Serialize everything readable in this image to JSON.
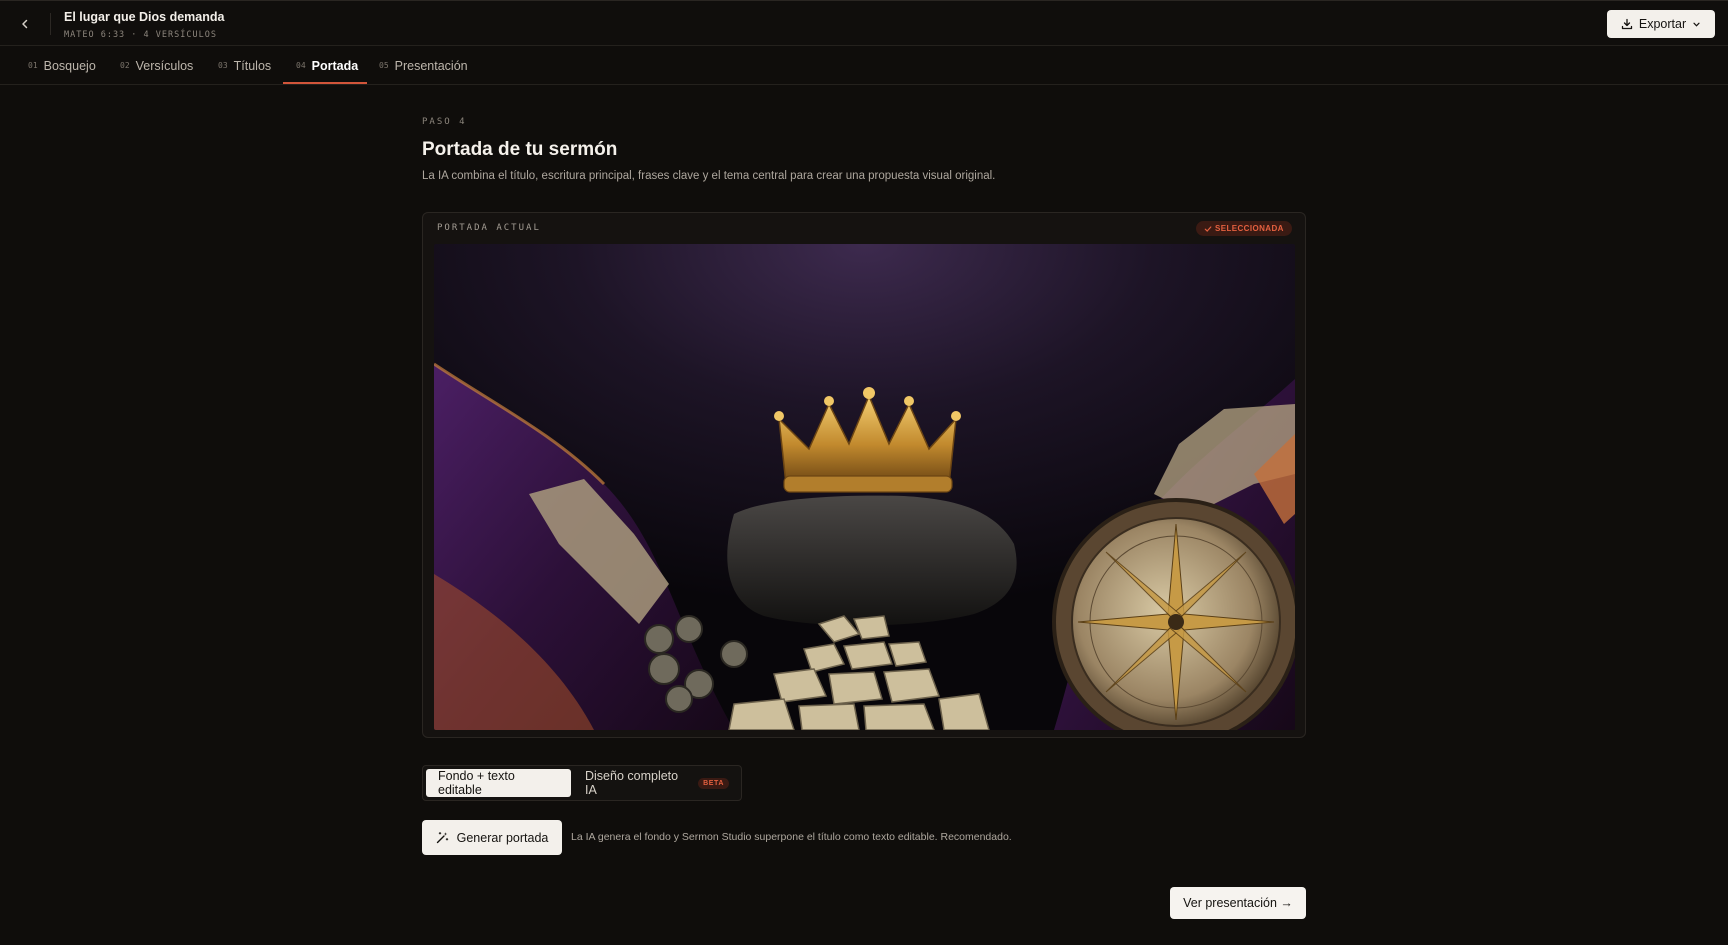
{
  "header": {
    "title": "El lugar que Dios demanda",
    "subtitle": "MATEO 6:33 · 4 VERSÍCULOS",
    "export_label": "Exportar"
  },
  "tabs": [
    {
      "num": "01",
      "label": "Bosquejo",
      "active": false
    },
    {
      "num": "02",
      "label": "Versículos",
      "active": false
    },
    {
      "num": "03",
      "label": "Títulos",
      "active": false
    },
    {
      "num": "04",
      "label": "Portada",
      "active": true
    },
    {
      "num": "05",
      "label": "Presentación",
      "active": false
    }
  ],
  "main": {
    "step_label": "PASO 4",
    "title": "Portada de tu sermón",
    "description": "La IA combina el título, escritura principal, frases clave y el tema central para crear una propuesta visual original."
  },
  "cover": {
    "label": "PORTADA ACTUAL",
    "badge": "SELECCIONADA"
  },
  "mode": {
    "options": [
      {
        "label": "Fondo + texto editable",
        "active": true
      },
      {
        "label": "Diseño completo IA",
        "active": false,
        "badge": "BETA"
      }
    ]
  },
  "generate": {
    "button_label": "Generar portada",
    "hint": "La IA genera el fondo y Sermon Studio superpone el título como texto editable. Recomendado."
  },
  "footer": {
    "next_label": "Ver presentación →"
  },
  "colors": {
    "background": "#0f0d0b",
    "accent": "#d2553a",
    "button_light": "#f3f0eb"
  }
}
